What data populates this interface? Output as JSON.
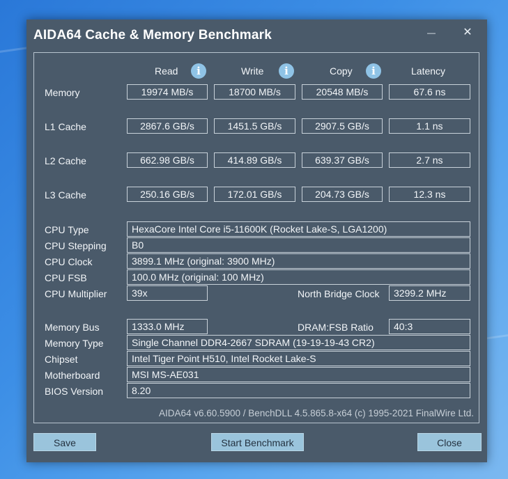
{
  "window": {
    "title": "AIDA64 Cache & Memory Benchmark",
    "minimize_glyph": "—",
    "close_glyph": "✕"
  },
  "columns": {
    "read": "Read",
    "write": "Write",
    "copy": "Copy",
    "latency": "Latency",
    "info_glyph": "i"
  },
  "rows": {
    "memory": {
      "label": "Memory",
      "read": "19974 MB/s",
      "write": "18700 MB/s",
      "copy": "20548 MB/s",
      "latency": "67.6 ns"
    },
    "l1": {
      "label": "L1 Cache",
      "read": "2867.6 GB/s",
      "write": "1451.5 GB/s",
      "copy": "2907.5 GB/s",
      "latency": "1.1 ns"
    },
    "l2": {
      "label": "L2 Cache",
      "read": "662.98 GB/s",
      "write": "414.89 GB/s",
      "copy": "639.37 GB/s",
      "latency": "2.7 ns"
    },
    "l3": {
      "label": "L3 Cache",
      "read": "250.16 GB/s",
      "write": "172.01 GB/s",
      "copy": "204.73 GB/s",
      "latency": "12.3 ns"
    }
  },
  "cpu": {
    "type_label": "CPU Type",
    "type_value": "HexaCore Intel Core i5-11600K  (Rocket Lake-S, LGA1200)",
    "stepping_label": "CPU Stepping",
    "stepping_value": "B0",
    "clock_label": "CPU Clock",
    "clock_value": "3899.1 MHz  (original: 3900 MHz)",
    "fsb_label": "CPU FSB",
    "fsb_value": "100.0 MHz  (original: 100 MHz)",
    "multiplier_label": "CPU Multiplier",
    "multiplier_value": "39x",
    "nb_clock_label": "North Bridge Clock",
    "nb_clock_value": "3299.2 MHz"
  },
  "memory_info": {
    "bus_label": "Memory Bus",
    "bus_value": "1333.0 MHz",
    "ratio_label": "DRAM:FSB Ratio",
    "ratio_value": "40:3",
    "type_label": "Memory Type",
    "type_value": "Single Channel DDR4-2667 SDRAM  (19-19-19-43 CR2)",
    "chipset_label": "Chipset",
    "chipset_value": "Intel Tiger Point H510, Intel Rocket Lake-S",
    "motherboard_label": "Motherboard",
    "motherboard_value": "MSI MS-AE031",
    "bios_label": "BIOS Version",
    "bios_value": "8.20"
  },
  "footer": "AIDA64 v6.60.5900 / BenchDLL 4.5.865.8-x64  (c) 1995-2021 FinalWire Ltd.",
  "buttons": {
    "save": "Save",
    "start": "Start Benchmark",
    "close": "Close"
  }
}
